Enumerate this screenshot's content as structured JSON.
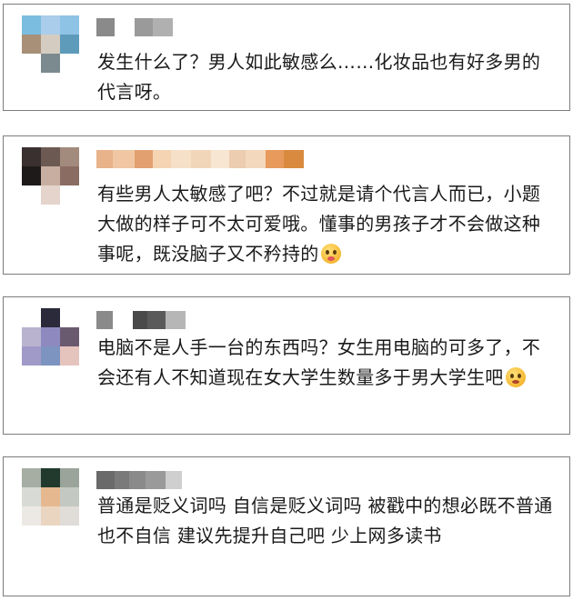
{
  "comments": [
    {
      "id": "c1",
      "avatar_colors": [
        "#7bbde0",
        "#a9cdea",
        "#8fc3e6",
        "#a89078",
        "#d4ccc0",
        "#5e9aba",
        "#ffffff",
        "#7b8a8e",
        "#ffffff"
      ],
      "name_colors": [
        "#8a8a8a",
        "#ffffff",
        "#9a9a9a",
        "#b0b0b0"
      ],
      "text": "发生什么了？男人如此敏感么……化妆品也有好多男的代言呀。",
      "emoji": ""
    },
    {
      "id": "c2",
      "avatar_colors": [
        "#3a3030",
        "#6c5a52",
        "#a28a7c",
        "#1e1a1a",
        "#c8aea0",
        "#8a6c62",
        "#ffffff",
        "#e4d4cc",
        "#ffffff"
      ],
      "name_colors": [
        "#e8b28a",
        "#f0c7a2",
        "#e2a070",
        "#f5d4b4",
        "#f6e0c8",
        "#f2d6ba",
        "#f7e6d2",
        "#eccdb0",
        "#f4d8bd",
        "#e89a5c",
        "#d98a3e"
      ],
      "text": "有些男人太敏感了吧？不过就是请个代言人而已，小题大做的样子可不太可爱哦。懂事的男孩子才不会做这种事呢，既没脑子又不矜持的",
      "emoji": "tongue"
    },
    {
      "id": "c3",
      "avatar_colors": [
        "#ffffff",
        "#2a2a3a",
        "#ffffff",
        "#b9b3cf",
        "#8e8ac0",
        "#6a5a70",
        "#a09ac8",
        "#7d94c0",
        "#e6c4be"
      ],
      "name_colors": [
        "#8a8a8a",
        "#ffffff",
        "#4a4a4a",
        "#5a5a5a",
        "#b6b6b6"
      ],
      "text": "电脑不是人手一台的东西吗？女生用电脑的可多了，不会还有人不知道现在女大学生数量多于男大学生吧",
      "emoji": "sad"
    },
    {
      "id": "c4",
      "avatar_colors": [
        "#a6aea4",
        "#223a2e",
        "#9aa49a",
        "#d8dad6",
        "#e6b890",
        "#c4c8c2",
        "#ece8e4",
        "#ead6c0",
        "#e0dcd8"
      ],
      "name_colors": [
        "#6a6a6a",
        "#7a7a7a",
        "#8a8a8a",
        "#9a9a9a",
        "#cfcfcf"
      ],
      "text": "普通是贬义词吗 自信是贬义词吗 被戳中的想必既不普通也不自信 建议先提升自己吧 少上网多读书",
      "emoji": ""
    }
  ]
}
